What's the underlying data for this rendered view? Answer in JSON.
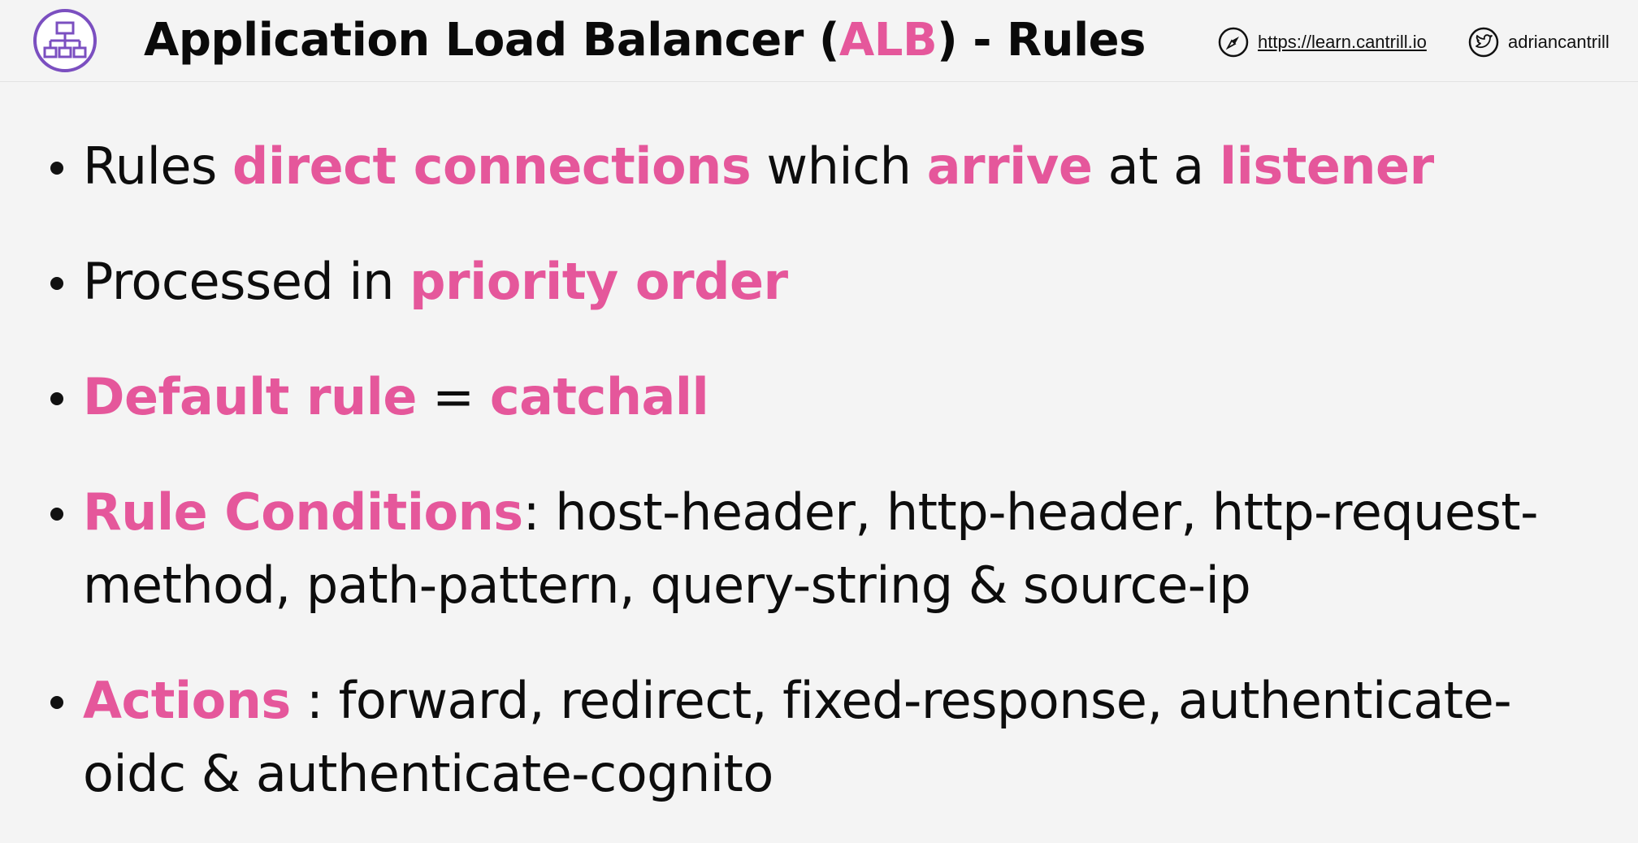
{
  "header": {
    "title_before": "Application Load Balancer (",
    "title_highlight": "ALB",
    "title_after": ") - Rules",
    "site_link": "https://learn.cantrill.io",
    "twitter_handle": "adriancantrill",
    "accent_color": "#e5579b"
  },
  "bullets": [
    {
      "parts": [
        {
          "t": "Rules ",
          "em": false
        },
        {
          "t": "direct connections",
          "em": true
        },
        {
          "t": " which ",
          "em": false
        },
        {
          "t": "arrive",
          "em": true
        },
        {
          "t": " at a ",
          "em": false
        },
        {
          "t": "listener",
          "em": true
        }
      ]
    },
    {
      "parts": [
        {
          "t": "Processed in ",
          "em": false
        },
        {
          "t": "priority order",
          "em": true
        }
      ]
    },
    {
      "parts": [
        {
          "t": "Default rule",
          "em": true
        },
        {
          "t": " = ",
          "em": false
        },
        {
          "t": "catchall",
          "em": true
        }
      ]
    },
    {
      "parts": [
        {
          "t": "Rule Conditions",
          "em": true
        },
        {
          "t": ": host-header, http-header, http-request-method, path-pattern, query-string & source-ip",
          "em": false
        }
      ]
    },
    {
      "parts": [
        {
          "t": "Actions",
          "em": true
        },
        {
          "t": " : forward, redirect, fixed-response, authenticate-oidc & authenticate-cognito",
          "em": false
        }
      ]
    }
  ]
}
